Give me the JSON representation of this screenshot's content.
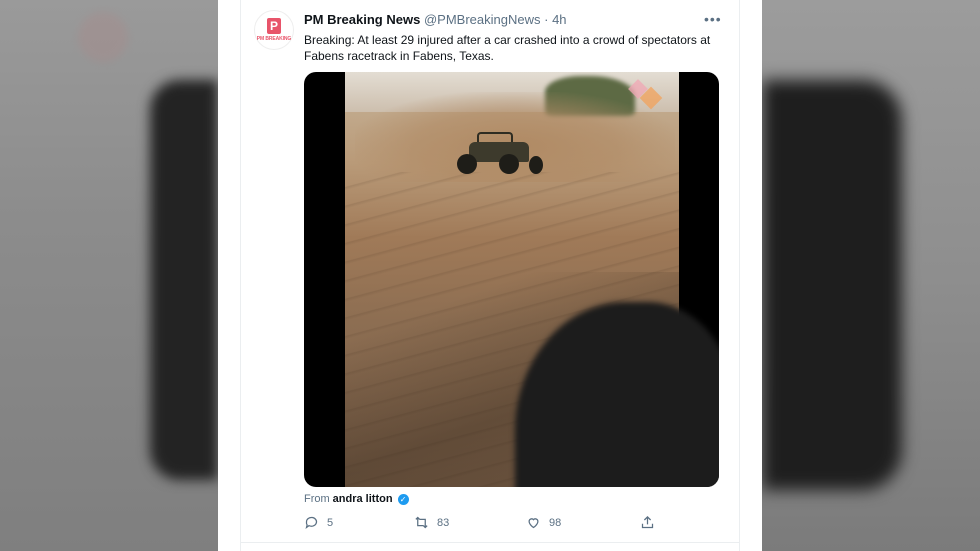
{
  "tweet": {
    "author_name": "PM Breaking News",
    "handle": "@PMBreakingNews",
    "separator": "·",
    "time": "4h",
    "more_label": "•••",
    "avatar_letter": "P",
    "avatar_brand": "PM BREAKING",
    "text": "Breaking: At least 29 injured after a car crashed into a crowd of spectators at Fabens racetrack in Fabens, Texas.",
    "source_prefix": "From",
    "source_account": "andra litton",
    "verified_icon": "verified-badge-icon"
  },
  "actions": {
    "reply_count": "5",
    "retweet_count": "83",
    "like_count": "98"
  },
  "colors": {
    "brand": "#e8546a",
    "text": "#0f1419",
    "muted": "#5b7083",
    "verified": "#1d9bf0"
  }
}
